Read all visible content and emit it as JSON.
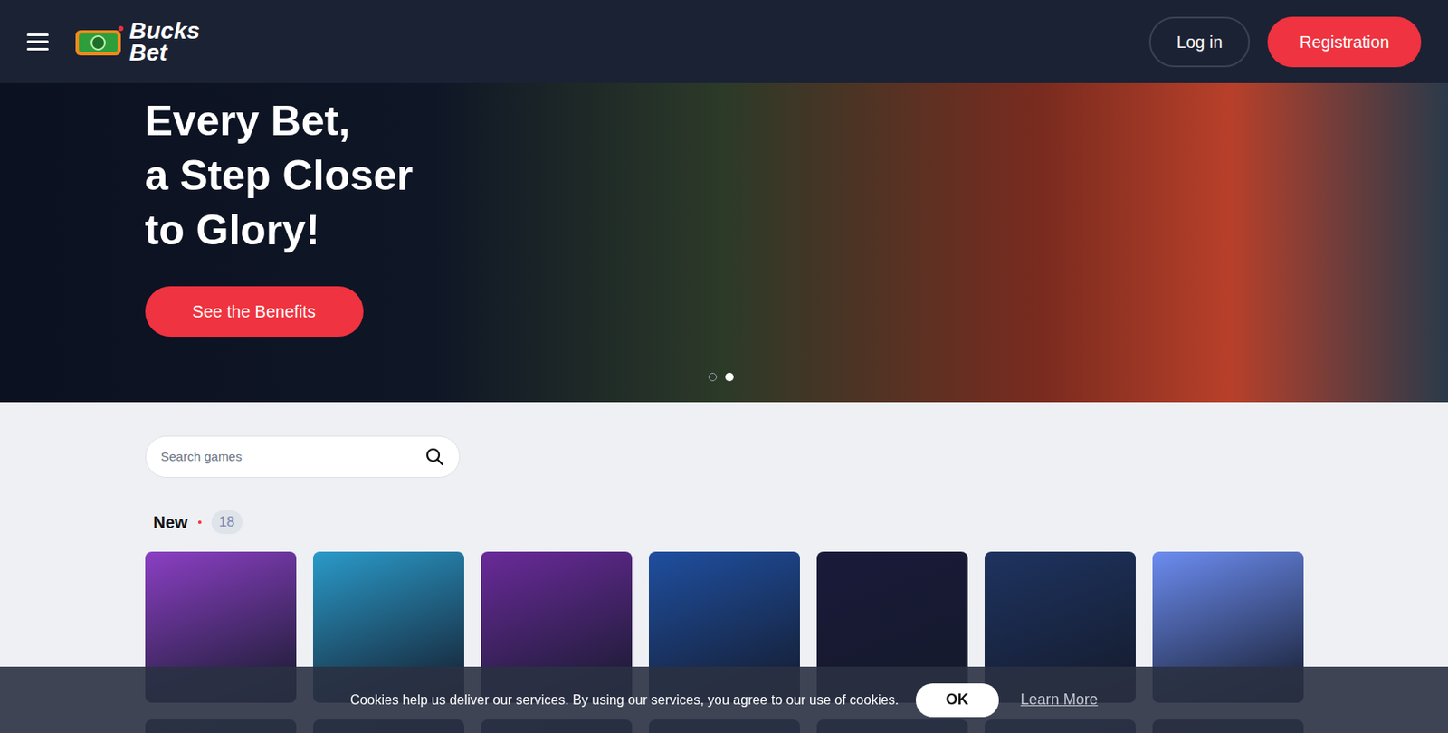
{
  "header": {
    "logo": {
      "line1": "Bucks",
      "line2": "Bet"
    },
    "buttons": [
      {
        "label": "Log in",
        "kind": "outline"
      },
      {
        "label": "Registration",
        "kind": "primary"
      }
    ]
  },
  "hero": {
    "title_lines": [
      "Every Bet,",
      "a Step Closer",
      "to Glory!"
    ],
    "button": "See the Benefits",
    "dots": [
      {
        "selected": false
      },
      {
        "selected": true
      }
    ]
  },
  "search": {
    "placeholder": "Search games"
  },
  "section": {
    "title": "New",
    "count": "18",
    "tiles": [
      {
        "color": "#8b3fc4"
      },
      {
        "color": "#2a9ac9"
      },
      {
        "color": "#6a2a9a"
      },
      {
        "color": "#1f4fa0"
      },
      {
        "color": "#1a1a3a"
      },
      {
        "color": "#1e3360"
      },
      {
        "color": "#6c8cf0"
      },
      {
        "color": "#1f3b4a"
      },
      {
        "color": "#1b2a55"
      },
      {
        "color": "#2a2a4a"
      },
      {
        "color": "#1f2f5a"
      },
      {
        "color": "#20304e"
      },
      {
        "color": "#243a5a"
      },
      {
        "color": "#2a2f45"
      }
    ]
  },
  "cookie": {
    "text": "Cookies help us deliver our services. By using our services, you agree to our use of cookies.",
    "button": "OK",
    "link": "Learn More"
  }
}
